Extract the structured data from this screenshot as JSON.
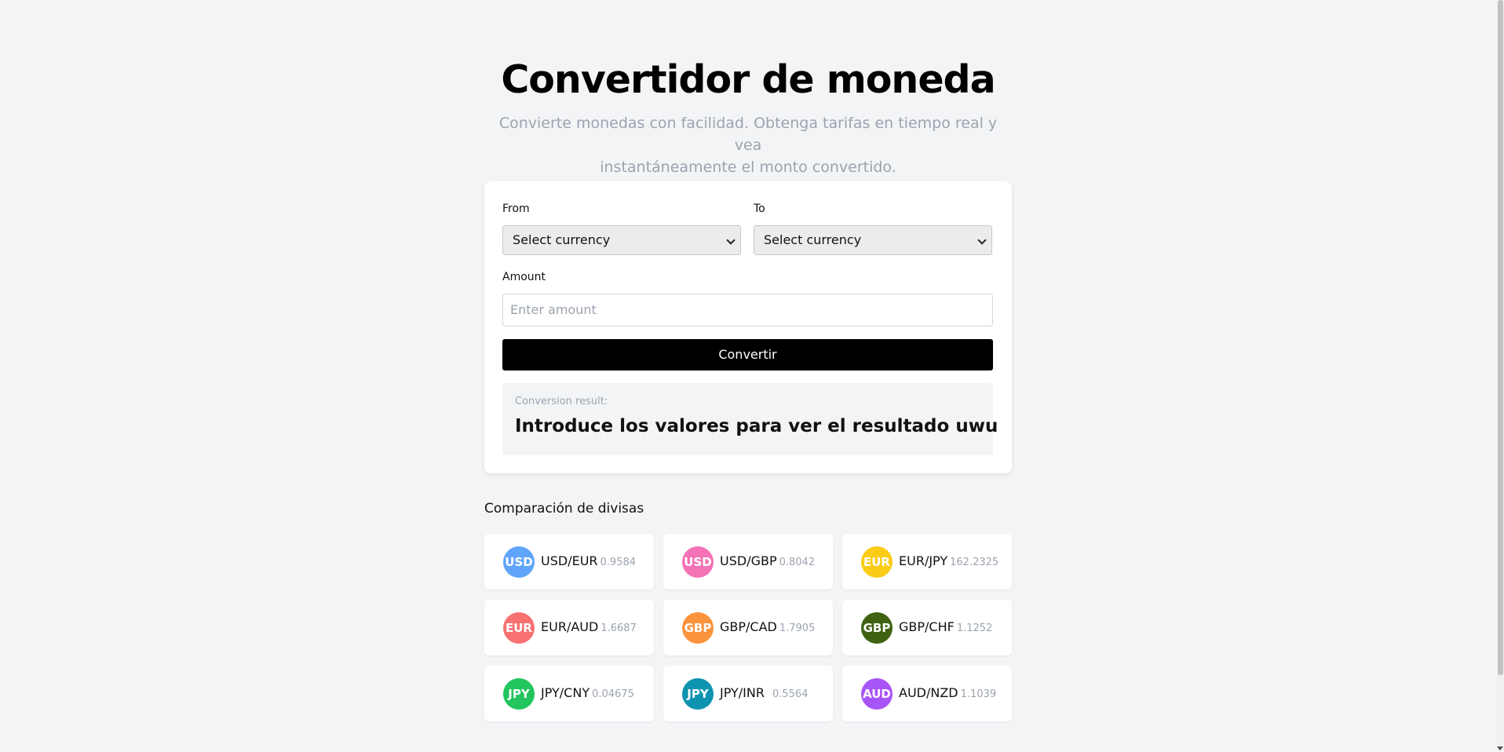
{
  "header": {
    "title": "Convertidor de moneda",
    "subtitle_line1": "Convierte monedas con facilidad. Obtenga tarifas en tiempo real y vea",
    "subtitle_line2": "instantáneamente el monto convertido."
  },
  "form": {
    "from_label": "From",
    "from_value": "Select currency",
    "to_label": "To",
    "to_value": "Select currency",
    "amount_label": "Amount",
    "amount_placeholder": "Enter amount",
    "convert_button": "Convertir",
    "result_label": "Conversion result:",
    "result_text": "Introduce los valores para ver el resultado uwu"
  },
  "comparison": {
    "title": "Comparación de divisas",
    "pairs": [
      {
        "base": "USD",
        "pair": "USD/EUR",
        "rate": "0.9584",
        "color": "#60a5fa"
      },
      {
        "base": "USD",
        "pair": "USD/GBP",
        "rate": "0.8042",
        "color": "#f472b6"
      },
      {
        "base": "EUR",
        "pair": "EUR/JPY",
        "rate": "162.2325",
        "color": "#facc15"
      },
      {
        "base": "EUR",
        "pair": "EUR/AUD",
        "rate": "1.6687",
        "color": "#f87171"
      },
      {
        "base": "GBP",
        "pair": "GBP/CAD",
        "rate": "1.7905",
        "color": "#fb923c"
      },
      {
        "base": "GBP",
        "pair": "GBP/CHF",
        "rate": "1.1252",
        "color": "#3f6212"
      },
      {
        "base": "JPY",
        "pair": "JPY/CNY",
        "rate": "0.04675",
        "color": "#22c55e"
      },
      {
        "base": "JPY",
        "pair": "JPY/INR",
        "rate": "0.5564",
        "color": "#0e93b0"
      },
      {
        "base": "AUD",
        "pair": "AUD/NZD",
        "rate": "1.1039",
        "color": "#a855f7"
      }
    ]
  }
}
